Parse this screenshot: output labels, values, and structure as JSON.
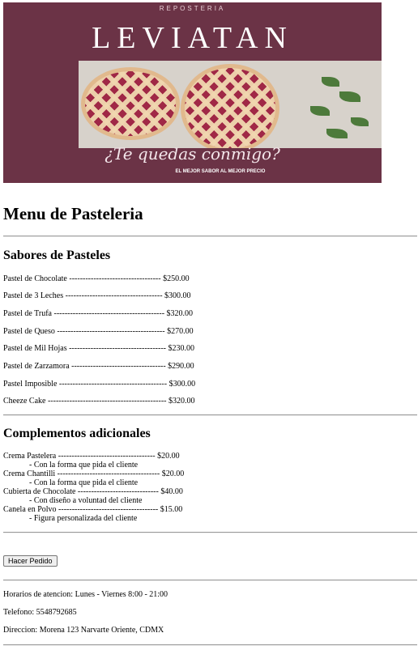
{
  "banner": {
    "kicker": "REPOSTERIA",
    "brand": "LEVIATAN",
    "tagline": "¿Te quedas conmigo?",
    "subtag": "EL MEJOR SABOR AL MEJOR PRECIO"
  },
  "page_title": "Menu de Pasteleria",
  "sabores": {
    "heading": "Sabores de Pasteles",
    "items": [
      "Pastel de Chocolate ---------------------------------- $250.00",
      "Pastel de 3 Leches ------------------------------------ $300.00",
      "Pastel de Trufa ----------------------------------------- $320.00",
      "Pastel de Queso ---------------------------------------- $270.00",
      "Pastel de Mil Hojas ------------------------------------ $230.00",
      "Pastel de Zarzamora ----------------------------------- $290.00",
      "Pastel Imposible ---------------------------------------- $300.00",
      "Cheeze Cake -------------------------------------------- $320.00"
    ]
  },
  "complementos": {
    "heading": "Complementos adicionales",
    "items": [
      {
        "line": "Crema Pastelera ------------------------------------ $20.00",
        "note": "- Con la forma que pida el cliente"
      },
      {
        "line": "Crema Chantilli -------------------------------------- $20.00",
        "note": "- Con la forma que pida el cliente"
      },
      {
        "line": "Cubierta de Chocolate ------------------------------ $40.00",
        "note": "- Con diseño a voluntad del cliente"
      },
      {
        "line": "Canela en Polvo ------------------------------------- $15.00",
        "note": "- Figura personalizada del cliente"
      }
    ]
  },
  "order_button": "Hacer Pedido",
  "info": {
    "horario": "Horarios de atencion: Lunes - Viernes 8:00 - 21:00",
    "telefono": "Telefono: 5548792685",
    "direccion": "Direccion: Morena 123 Narvarte Oriente, CDMX"
  }
}
